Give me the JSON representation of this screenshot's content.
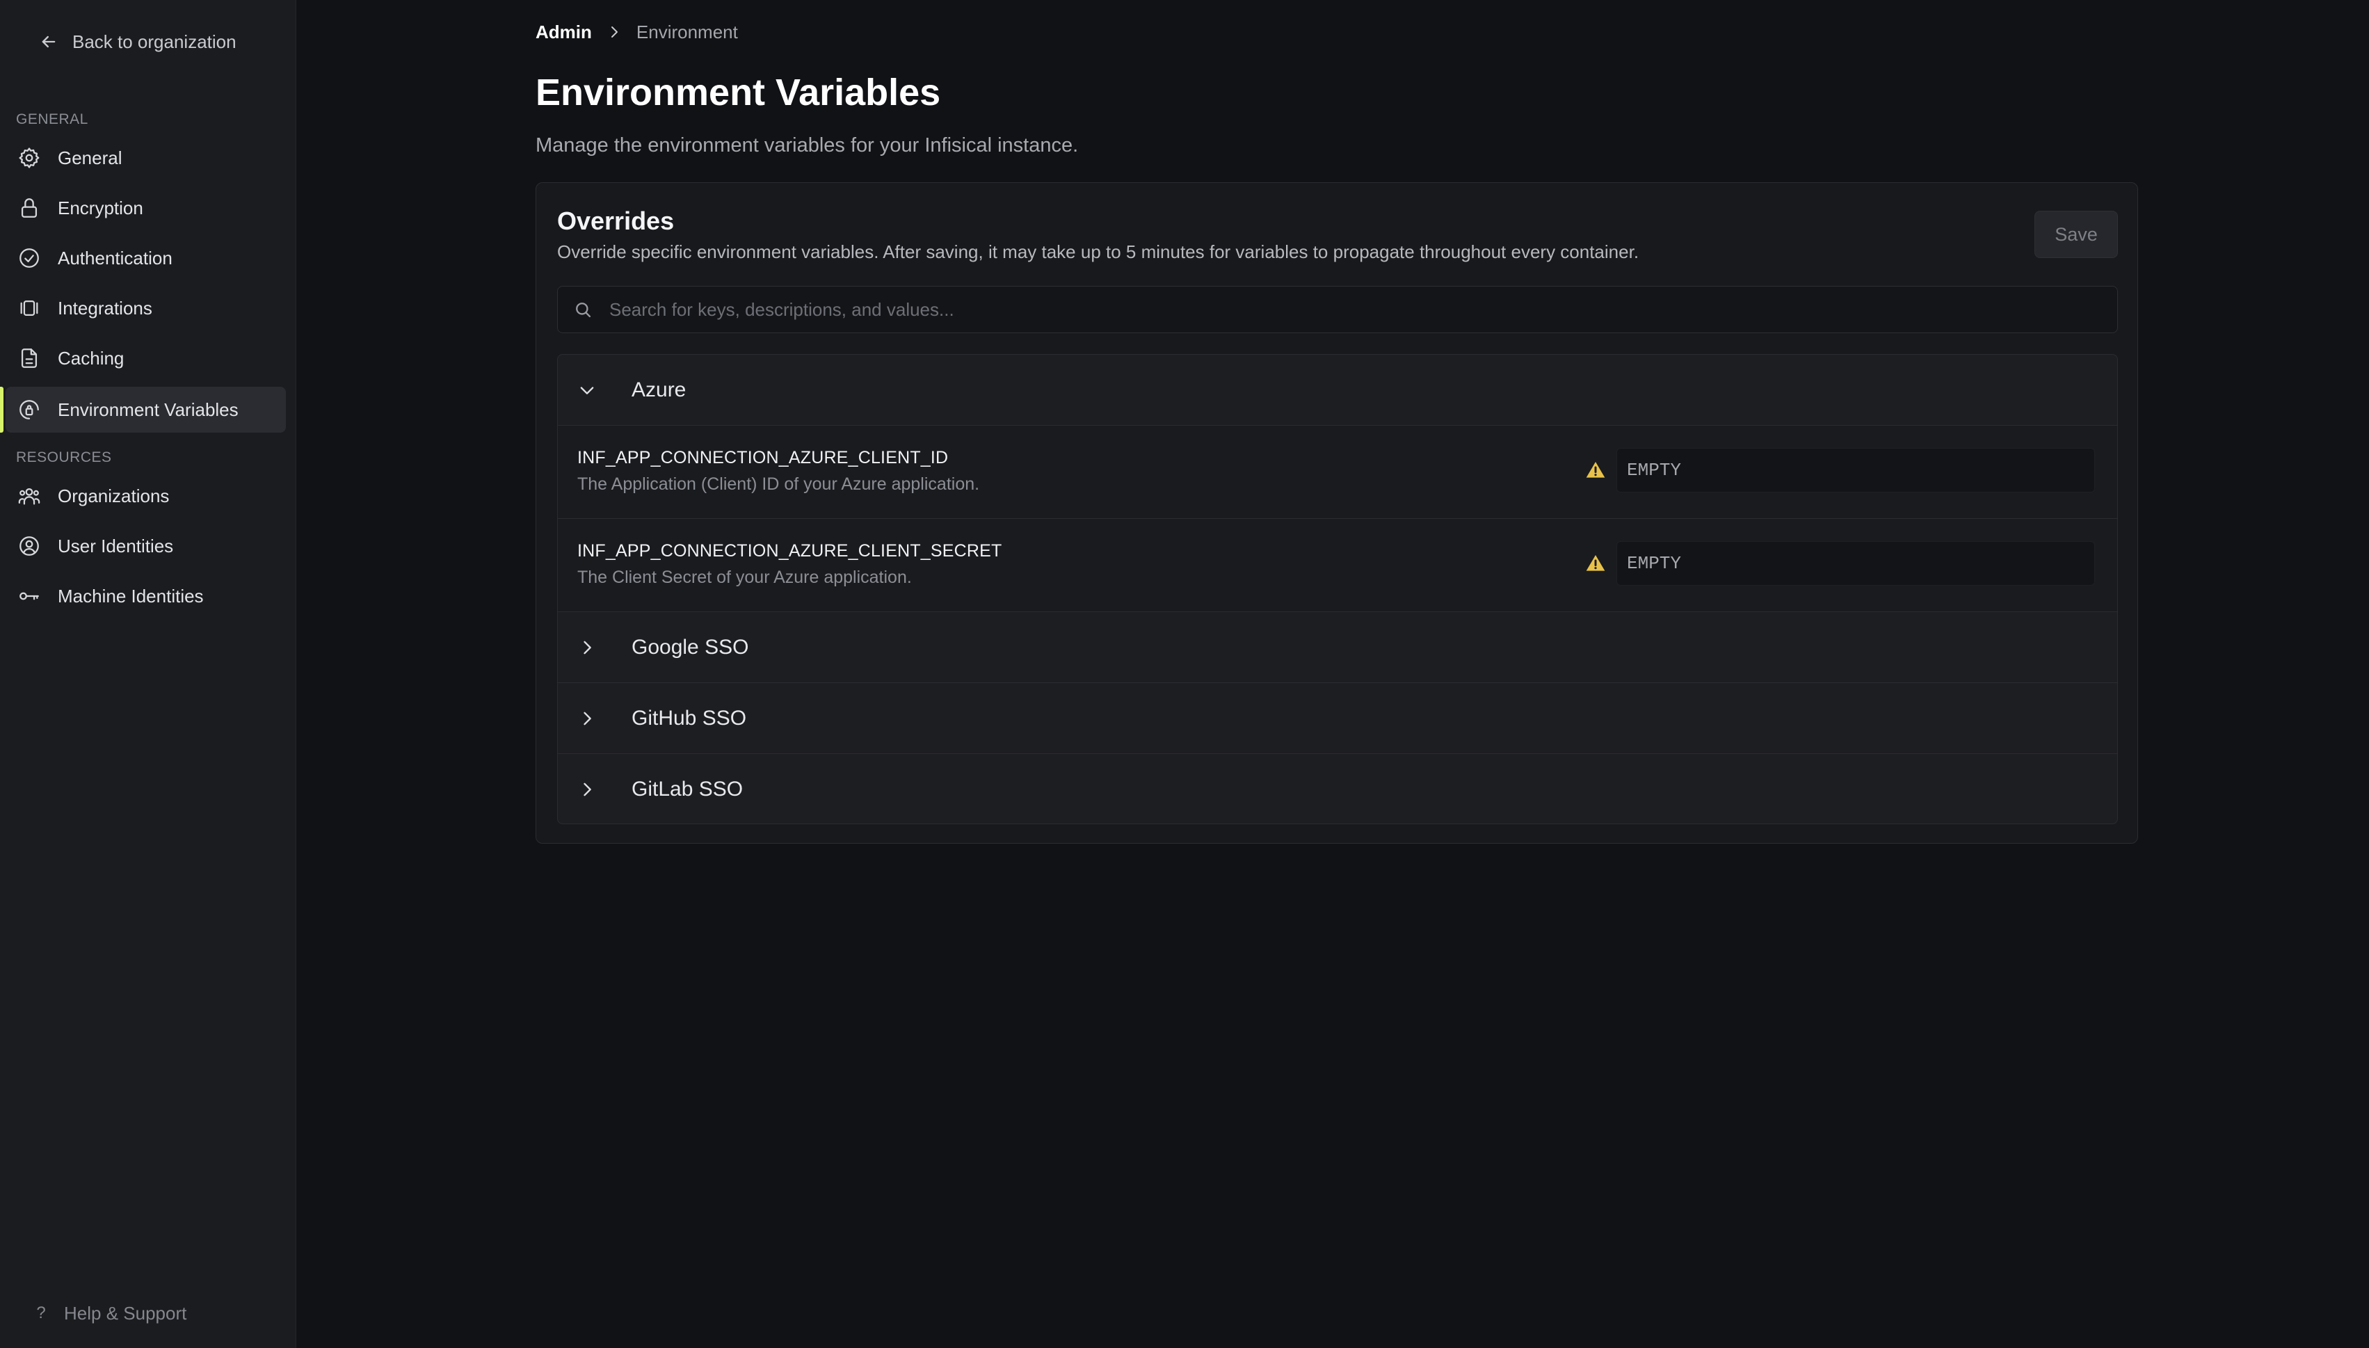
{
  "sidebar": {
    "back_label": "Back to organization",
    "sections": {
      "general_label": "GENERAL",
      "resources_label": "RESOURCES"
    },
    "general_items": [
      {
        "label": "General",
        "icon": "gear-icon"
      },
      {
        "label": "Encryption",
        "icon": "lock-icon"
      },
      {
        "label": "Authentication",
        "icon": "check-circle-icon"
      },
      {
        "label": "Integrations",
        "icon": "integrations-icon"
      },
      {
        "label": "Caching",
        "icon": "document-icon"
      },
      {
        "label": "Environment Variables",
        "icon": "lock-circle-icon",
        "active": true
      }
    ],
    "resource_items": [
      {
        "label": "Organizations",
        "icon": "users-icon"
      },
      {
        "label": "User Identities",
        "icon": "user-circle-icon"
      },
      {
        "label": "Machine Identities",
        "icon": "key-icon"
      }
    ],
    "help_label": "Help & Support",
    "accent_color": "#d7f36a"
  },
  "breadcrumb": {
    "root": "Admin",
    "current": "Environment"
  },
  "page": {
    "title": "Environment Variables",
    "subtitle": "Manage the environment variables for your Infisical instance."
  },
  "overrides": {
    "title": "Overrides",
    "description": "Override specific environment variables. After saving, it may take up to 5 minutes for variables to propagate throughout every container.",
    "save_label": "Save",
    "search_placeholder": "Search for keys, descriptions, and values...",
    "groups": [
      {
        "name": "Azure",
        "expanded": true,
        "variables": [
          {
            "key": "INF_APP_CONNECTION_AZURE_CLIENT_ID",
            "description": "The Application (Client) ID of your Azure application.",
            "placeholder": "EMPTY",
            "warning": true
          },
          {
            "key": "INF_APP_CONNECTION_AZURE_CLIENT_SECRET",
            "description": "The Client Secret of your Azure application.",
            "placeholder": "EMPTY",
            "warning": true
          }
        ]
      },
      {
        "name": "Google SSO",
        "expanded": false
      },
      {
        "name": "GitHub SSO",
        "expanded": false
      },
      {
        "name": "GitLab SSO",
        "expanded": false
      }
    ],
    "warning_color": "#e8c24a"
  }
}
